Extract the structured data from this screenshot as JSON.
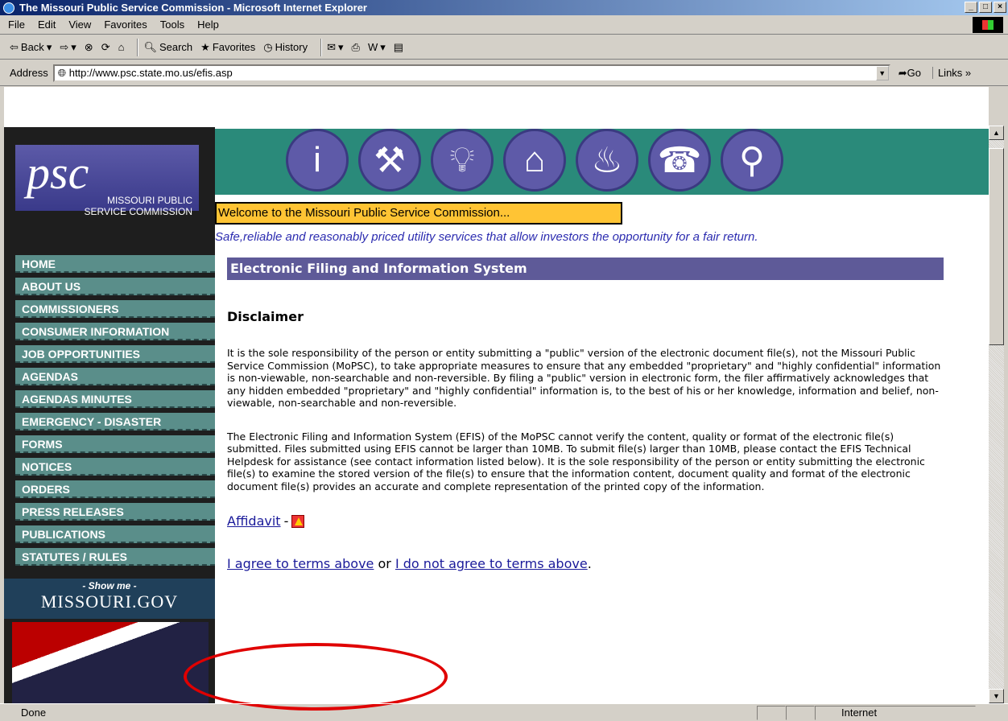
{
  "window": {
    "title": "The Missouri Public Service Commission - Microsoft Internet Explorer",
    "controls": [
      "_",
      "□",
      "×"
    ]
  },
  "menu": [
    "File",
    "Edit",
    "View",
    "Favorites",
    "Tools",
    "Help"
  ],
  "toolbar": {
    "back": "Back",
    "search": "Search",
    "favorites": "Favorites",
    "history": "History"
  },
  "address": {
    "label": "Address",
    "url": "http://www.psc.state.mo.us/efis.asp",
    "go": "Go",
    "links": "Links"
  },
  "page": {
    "logo": {
      "text": "psc",
      "sub1": "MISSOURI PUBLIC",
      "sub2": "SERVICE COMMISSION"
    },
    "header_icons": [
      "info-icon",
      "gavel-icon",
      "lightbulb-icon",
      "house-icon",
      "flame-icon",
      "phone-icon",
      "faucet-icon"
    ],
    "welcome": "Welcome to the Missouri Public Service Commission...",
    "tagline": "Safe,reliable and reasonably priced utility services that allow investors the opportunity for a fair return.",
    "nav": [
      "HOME",
      "ABOUT US",
      "COMMISSIONERS",
      "CONSUMER INFORMATION",
      "JOB OPPORTUNITIES",
      "AGENDAS",
      "AGENDAS MINUTES",
      "EMERGENCY - DISASTER",
      "FORMS",
      "NOTICES",
      "ORDERS",
      "PRESS RELEASES",
      "PUBLICATIONS",
      "STATUTES / RULES"
    ],
    "showme": {
      "line1": "- Show me -",
      "line2": "MISSOURI.GOV"
    },
    "section_title": "Electronic Filing and Information System",
    "disclaimer_heading": "Disclaimer",
    "para1": "It is the sole responsibility of the person or entity submitting a \"public\" version of the electronic document file(s), not the Missouri Public Service Commission (MoPSC), to take appropriate measures to ensure that any embedded \"proprietary\" and \"highly confidential\" information is non-viewable, non-searchable and non-reversible. By filing a \"public\" version in electronic form, the filer affirmatively acknowledges that any hidden embedded \"proprietary\" and \"highly confidential\" information is, to the best of his or her knowledge, information and belief, non-viewable, non-searchable and non-reversible.",
    "para2": "The Electronic Filing and Information System (EFIS) of the MoPSC cannot verify the content, quality or format of the electronic file(s) submitted. Files submitted using EFIS cannot be larger than 10MB. To submit file(s) larger than 10MB, please contact the EFIS Technical Helpdesk for assistance (see contact information listed below). It is the sole responsibility of the person or entity submitting the electronic file(s) to examine the stored version of the file(s) to ensure that the information content, document quality and format of the electronic document file(s) provides an accurate and complete representation of the printed copy of the information.",
    "affidavit": "Affidavit",
    "affidavit_sep": "-",
    "agree": "I agree to terms above",
    "or": "or",
    "disagree": "I do not agree to terms above",
    "period": "."
  },
  "status": {
    "left": "Done",
    "zone": "Internet"
  }
}
